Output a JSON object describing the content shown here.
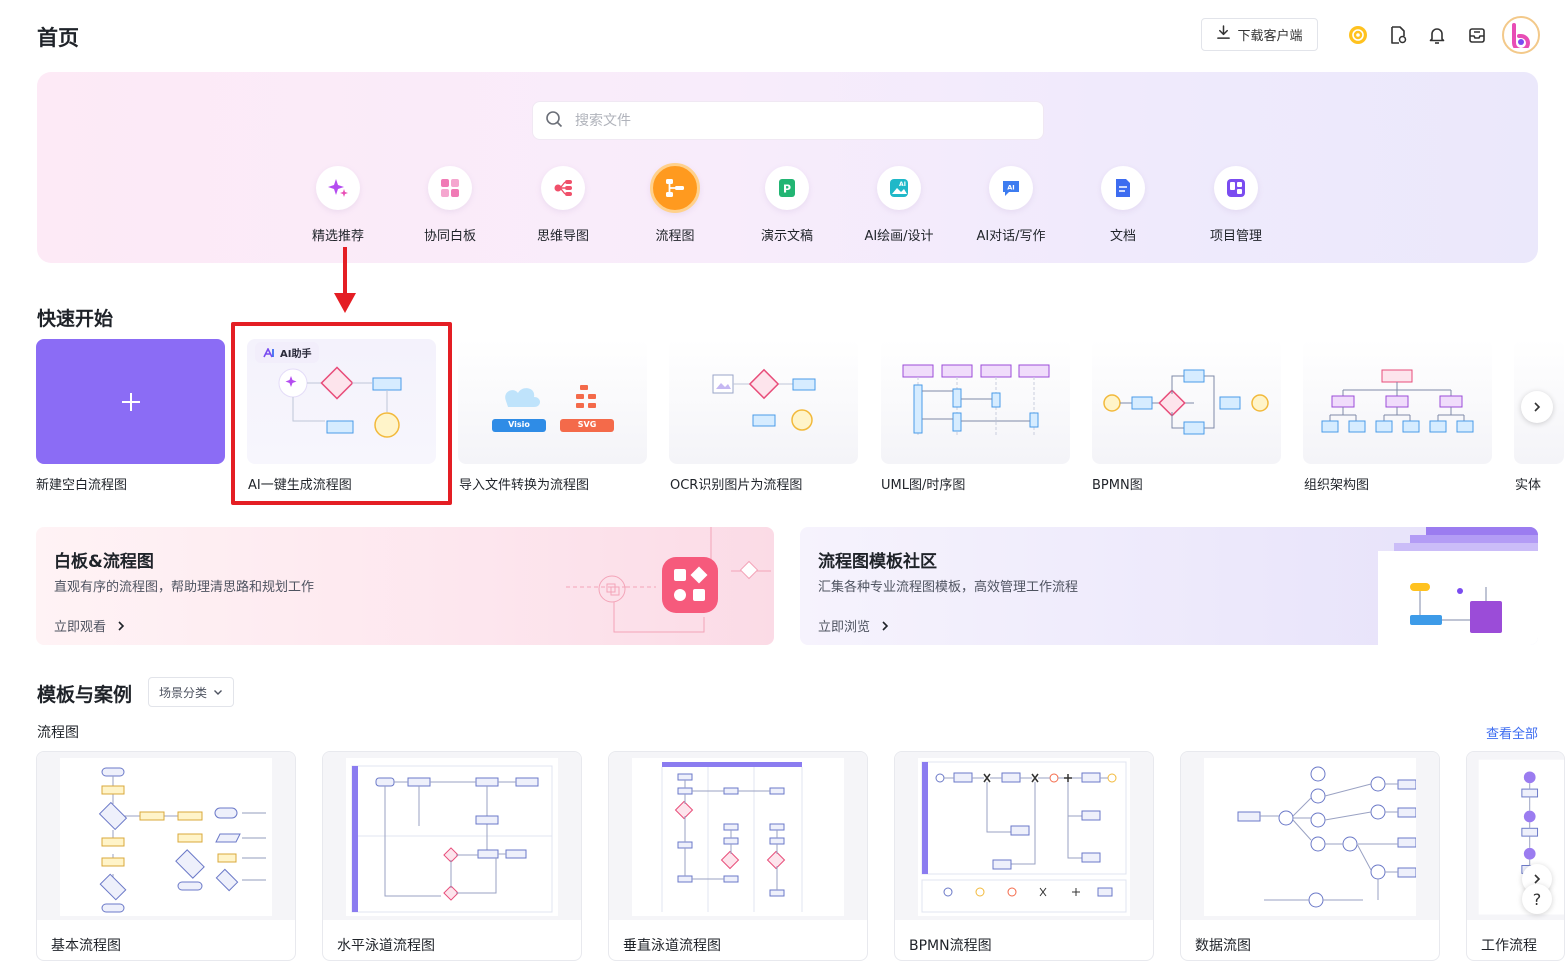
{
  "header": {
    "title": "首页",
    "download_label": "下载客户端",
    "icons": [
      "coin-icon",
      "document-edit-icon",
      "bell-icon",
      "inbox-icon",
      "avatar-icon"
    ]
  },
  "search": {
    "placeholder": "搜索文件"
  },
  "categories": [
    {
      "label": "精选推荐",
      "icon": "sparkle-icon",
      "color": "#b44cf0"
    },
    {
      "label": "协同白板",
      "icon": "whiteboard-icon",
      "color": "#f07ab5"
    },
    {
      "label": "思维导图",
      "icon": "mindmap-icon",
      "color": "#f0506a"
    },
    {
      "label": "流程图",
      "icon": "flowchart-icon",
      "color": "#ff9a1f",
      "active": true
    },
    {
      "label": "演示文稿",
      "icon": "presentation-icon",
      "color": "#22b573"
    },
    {
      "label": "AI绘画/设计",
      "icon": "ai-image-icon",
      "color": "#1fb8c8"
    },
    {
      "label": "AI对话/写作",
      "icon": "ai-chat-icon",
      "color": "#3d7cf0"
    },
    {
      "label": "文档",
      "icon": "document-icon",
      "color": "#3d6cf0"
    },
    {
      "label": "项目管理",
      "icon": "kanban-icon",
      "color": "#7a4cf0"
    }
  ],
  "quick_start": {
    "title": "快速开始",
    "ai_badge": "AI助手",
    "visio_tag": "Visio",
    "svg_tag": "SVG",
    "items": [
      {
        "label": "新建空白流程图"
      },
      {
        "label": "AI一键生成流程图"
      },
      {
        "label": "导入文件转换为流程图"
      },
      {
        "label": "OCR识别图片为流程图"
      },
      {
        "label": "UML图/时序图"
      },
      {
        "label": "BPMN图"
      },
      {
        "label": "组织架构图"
      },
      {
        "label": "实体"
      }
    ]
  },
  "banners": {
    "left": {
      "title": "白板&流程图",
      "desc": "直观有序的流程图，帮助理清思路和规划工作",
      "link": "立即观看"
    },
    "right": {
      "title": "流程图模板社区",
      "desc": "汇集各种专业流程图模板，高效管理工作流程",
      "link": "立即浏览"
    }
  },
  "templates": {
    "title": "模板与案例",
    "filter_label": "场景分类",
    "subsection": "流程图",
    "view_all": "查看全部",
    "items": [
      {
        "name": "基本流程图"
      },
      {
        "name": "水平泳道流程图"
      },
      {
        "name": "垂直泳道流程图"
      },
      {
        "name": "BPMN流程图"
      },
      {
        "name": "数据流图"
      },
      {
        "name": "工作流程"
      }
    ]
  },
  "colors": {
    "accent": "#8b6cf5",
    "highlight": "#e41e24",
    "link": "#3d6cf0"
  }
}
